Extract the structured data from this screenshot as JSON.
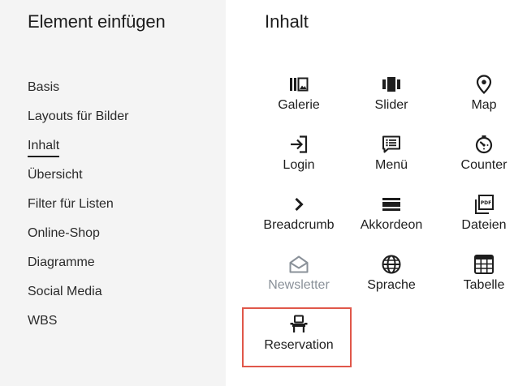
{
  "sidebar": {
    "title": "Element einfügen",
    "items": [
      {
        "label": "Basis"
      },
      {
        "label": "Layouts für Bilder"
      },
      {
        "label": "Inhalt",
        "active": true
      },
      {
        "label": "Übersicht"
      },
      {
        "label": "Filter für Listen"
      },
      {
        "label": "Online-Shop"
      },
      {
        "label": "Diagramme"
      },
      {
        "label": "Social Media"
      },
      {
        "label": "WBS"
      }
    ]
  },
  "main": {
    "title": "Inhalt",
    "tiles": [
      {
        "label": "Galerie",
        "icon": "gallery-icon"
      },
      {
        "label": "Slider",
        "icon": "slider-icon"
      },
      {
        "label": "Map",
        "icon": "map-pin-icon"
      },
      {
        "label": "Login",
        "icon": "login-icon"
      },
      {
        "label": "Menü",
        "icon": "menu-icon"
      },
      {
        "label": "Counter",
        "icon": "counter-icon"
      },
      {
        "label": "Breadcrumb",
        "icon": "chevron-right-icon"
      },
      {
        "label": "Akkordeon",
        "icon": "accordion-icon"
      },
      {
        "label": "Dateien",
        "icon": "pdf-file-icon"
      },
      {
        "label": "Newsletter",
        "icon": "envelope-open-icon",
        "disabled": true
      },
      {
        "label": "Sprache",
        "icon": "globe-icon"
      },
      {
        "label": "Tabelle",
        "icon": "table-icon"
      },
      {
        "label": "Reservation",
        "icon": "chair-icon",
        "selected": true
      }
    ]
  },
  "colors": {
    "sidebar_bg": "#f4f4f4",
    "selection_border": "#e0574a",
    "disabled_text": "#8a9199"
  }
}
